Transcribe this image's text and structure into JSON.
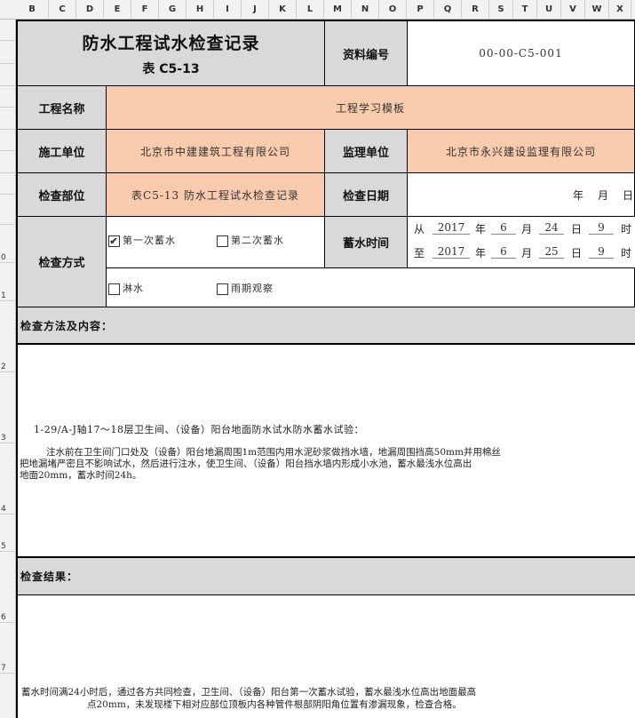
{
  "columns": [
    "B",
    "C",
    "D",
    "E",
    "F",
    "G",
    "H",
    "I",
    "J",
    "K",
    "L",
    "M",
    "N",
    "O",
    "P",
    "Q",
    "R",
    "S",
    "T",
    "U",
    "V",
    "W",
    "X"
  ],
  "rows": [
    "",
    "",
    "",
    "",
    "",
    "",
    "",
    "",
    "",
    "0",
    "1",
    "2",
    "3",
    "4",
    "5",
    "6",
    "7"
  ],
  "header": {
    "title": "防水工程试水检查记录",
    "subtitle": "表 C5-13",
    "doc_no_label": "资料编号",
    "doc_no": "00-00-C5-001"
  },
  "project": {
    "label": "工程名称",
    "value": "工程学习模板"
  },
  "contractor": {
    "label": "施工单位",
    "value": "北京市中建建筑工程有限公司"
  },
  "supervisor": {
    "label": "监理单位",
    "value": "北京市永兴建设监理有限公司"
  },
  "location": {
    "label": "检查部位",
    "value": "表C5-13 防水工程试水检查记录"
  },
  "check_date": {
    "label": "检查日期",
    "year": "年",
    "month": "月",
    "day": "日"
  },
  "method": {
    "label": "检查方式",
    "options": [
      {
        "label": "第一次蓄水",
        "checked": true,
        "mark": "✔"
      },
      {
        "label": "第二次蓄水",
        "checked": false,
        "mark": ""
      },
      {
        "label": "淋水",
        "checked": false,
        "mark": ""
      },
      {
        "label": "雨期观察",
        "checked": false,
        "mark": ""
      }
    ]
  },
  "storage_time": {
    "label": "蓄水时间",
    "from_label": "从",
    "to_label": "至",
    "from": {
      "year": "2017",
      "month": "6",
      "day": "24",
      "hour": "9"
    },
    "to": {
      "year": "2017",
      "month": "6",
      "day": "25",
      "hour": "9"
    },
    "u_year": "年",
    "u_month": "月",
    "u_day": "日",
    "u_hour": "时"
  },
  "content": {
    "label": "检查方法及内容：",
    "line1": "1-29/A-J轴17～18层卫生间、（设备）阳台地面防水试水防水蓄水试验：",
    "line2": "注水前在卫生间门口处及（设备）阳台地漏周围1m范围内用水泥砂浆做挡水墙，地漏周围挡高50mm并用棉丝",
    "line3": "把地漏堵严密且不影响试水，然后进行注水，使卫生间、（设备）阳台挡水墙内形成小水池，蓄水最浅水位高出",
    "line4": "地面20mm，蓄水时间24h。"
  },
  "result": {
    "label": "检查结果：",
    "line1": "蓄水时间满24小时后，通过各方共同检查，卫生间、（设备）阳台第一次蓄水试验，蓄水最浅水位高出地面最高",
    "line2": "点20mm，未发现楼下相对应部位顶板内各种管件根部阴阳角位置有渗漏现象，检查合格。"
  }
}
